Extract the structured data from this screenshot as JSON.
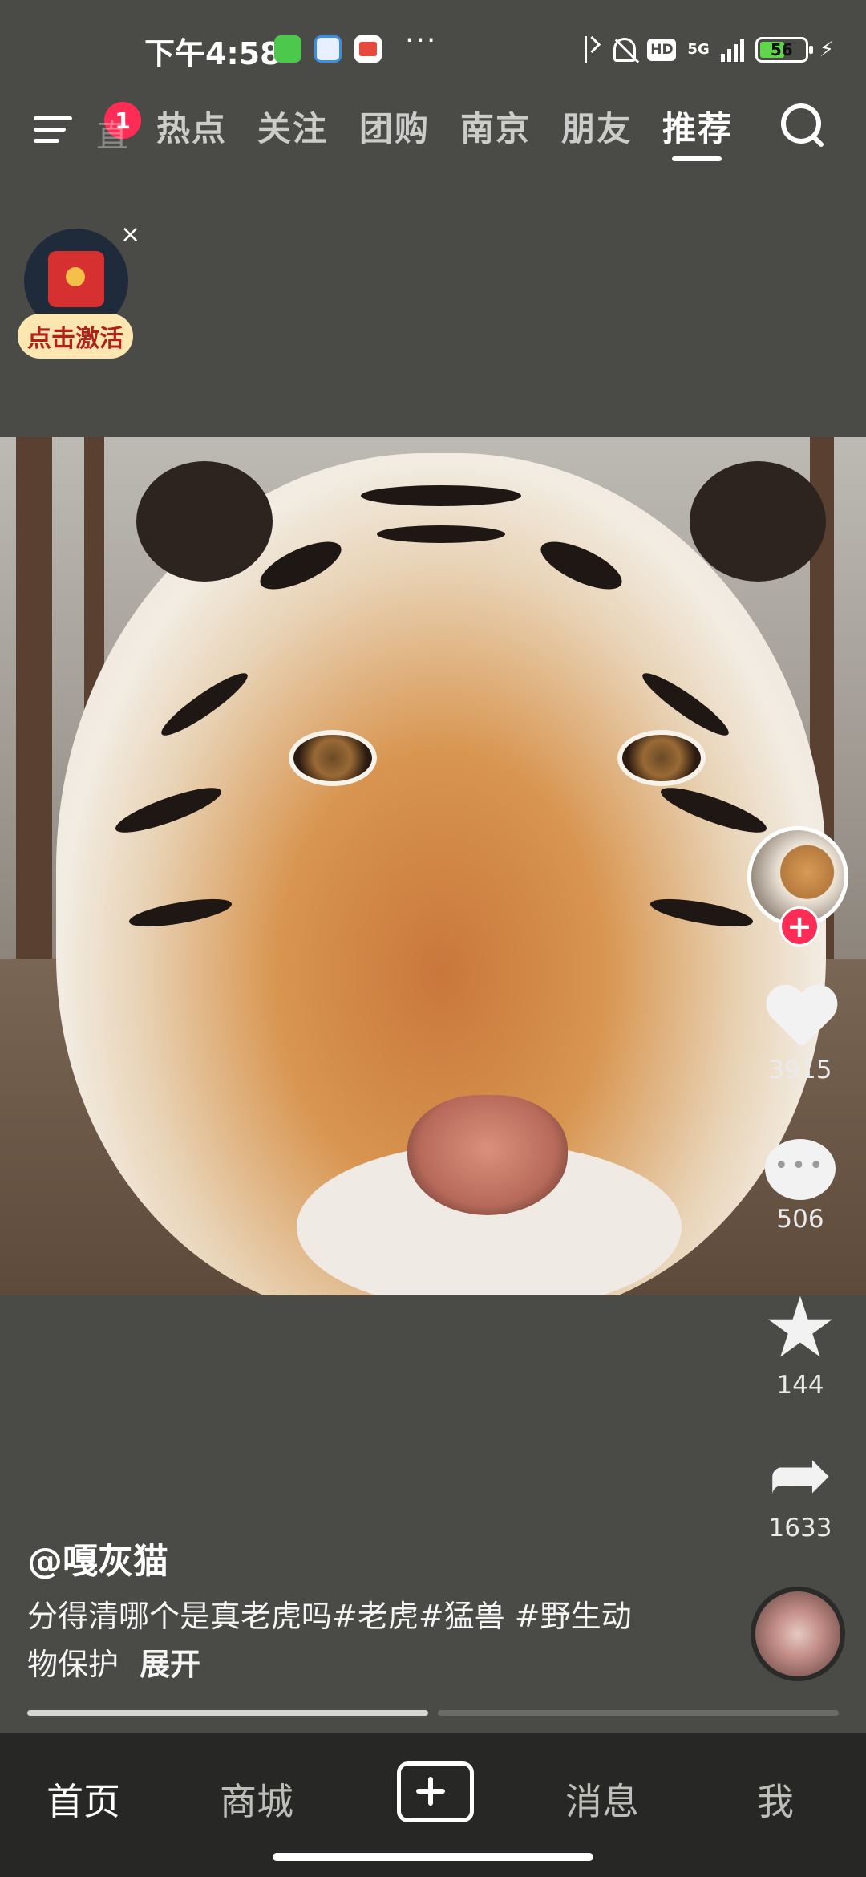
{
  "status_bar": {
    "time": "下午4:58",
    "more_indicator": "···",
    "network": "5G",
    "hd": "HD",
    "battery": "56",
    "battery_level": 0.56
  },
  "top_nav": {
    "menu_badge": "1",
    "faded_tab": "直播",
    "tabs": [
      "热点",
      "关注",
      "团购",
      "南京",
      "朋友",
      "推荐"
    ],
    "active_tab": "推荐"
  },
  "promo": {
    "label": "点击激活",
    "close_glyph": "×"
  },
  "rail": {
    "like_count": "3915",
    "comment_count": "506",
    "favorite_count": "144",
    "share_count": "1633",
    "follow_glyph": "+"
  },
  "post": {
    "author": "@嘎灰猫",
    "caption": "分得清哪个是真老虎吗#老虎#猛兽 #野生动物保护",
    "expand_label": "展开"
  },
  "progress": {
    "segment1_fill": 1.0,
    "segment2_fill": 0.0
  },
  "bottom_nav": {
    "home": "首页",
    "mall": "商城",
    "messages": "消息",
    "me": "我"
  },
  "colors": {
    "accent": "#ff2d55",
    "background": "#4a4a46",
    "nav_background": "#272725"
  }
}
